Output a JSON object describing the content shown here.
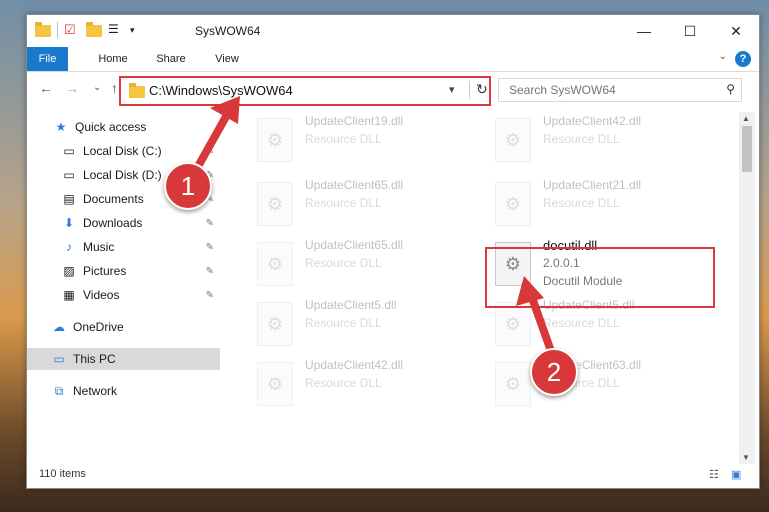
{
  "window": {
    "title": "SysWOW64"
  },
  "controls": {
    "minimize": "—",
    "maximize": "☐",
    "close": "✕"
  },
  "ribbon": {
    "tabs": [
      "File",
      "Home",
      "Share",
      "View"
    ],
    "help": "?"
  },
  "nav": {
    "back": "←",
    "forward": "→",
    "recent": "⌄",
    "up": "↑",
    "address": "C:\\Windows\\SysWOW64",
    "search_placeholder": "Search SysWOW64"
  },
  "sidebar": {
    "items": [
      {
        "label": "Quick access",
        "icon": "star-icon",
        "pinned": false
      },
      {
        "label": "Local Disk (C:)",
        "icon": "drive-icon",
        "pinned": true
      },
      {
        "label": "Local Disk (D:)",
        "icon": "drive-icon",
        "pinned": true
      },
      {
        "label": "Documents",
        "icon": "document-icon",
        "pinned": true
      },
      {
        "label": "Downloads",
        "icon": "download-icon",
        "pinned": true
      },
      {
        "label": "Music",
        "icon": "music-icon",
        "pinned": true
      },
      {
        "label": "Pictures",
        "icon": "picture-icon",
        "pinned": true
      },
      {
        "label": "Videos",
        "icon": "video-icon",
        "pinned": true
      },
      {
        "label": "OneDrive",
        "icon": "cloud-icon",
        "pinned": false
      },
      {
        "label": "This PC",
        "icon": "pc-icon",
        "pinned": false,
        "selected": true
      },
      {
        "label": "Network",
        "icon": "network-icon",
        "pinned": false
      }
    ]
  },
  "files": [
    {
      "name": "UpdateClient19.dll",
      "type": "Resource DLL"
    },
    {
      "name": "UpdateClient42.dll",
      "type": "Resource DLL"
    },
    {
      "name": "UpdateClient65.dll",
      "type": "Resource DLL"
    },
    {
      "name": "UpdateClient21.dll",
      "type": "Resource DLL"
    },
    {
      "name": "UpdateClient65.dll",
      "type": "Resource DLL"
    },
    {
      "name": "docutil.dll",
      "type": "2.0.0.1",
      "desc": "Docutil Module",
      "highlighted": true
    },
    {
      "name": "UpdateClient5.dll",
      "type": "Resource DLL"
    },
    {
      "name": "UpdateClient5.dll",
      "type": "Resource DLL"
    },
    {
      "name": "UpdateClient42.dll",
      "type": "Resource DLL"
    },
    {
      "name": "UpdateClient63.dll",
      "type": "Resource DLL"
    }
  ],
  "status": {
    "count": "110 items"
  },
  "annotations": [
    "1",
    "2"
  ],
  "colors": {
    "accent": "#1979ca",
    "annotation": "#d9383a"
  }
}
